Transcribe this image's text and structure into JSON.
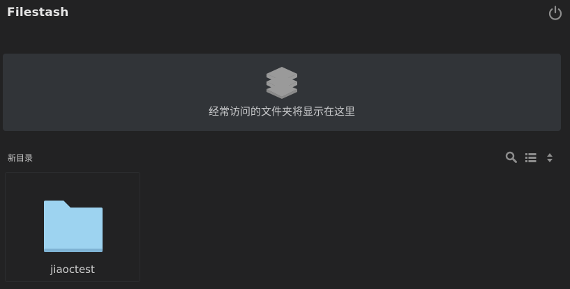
{
  "header": {
    "app_title": "Filestash",
    "power_icon": "power-icon"
  },
  "frequent": {
    "icon": "layers-icon",
    "message": "经常访问的文件夹将显示在这里"
  },
  "section": {
    "title": "新目录",
    "tools": [
      "search-icon",
      "list-view-icon",
      "sort-icon"
    ]
  },
  "files": [
    {
      "name": "jiaoctest",
      "type": "folder",
      "icon": "folder-icon"
    }
  ],
  "colors": {
    "background": "#222223",
    "panel": "#313438",
    "folder": "#9dd3f0",
    "folder_dark": "#7fb3d4",
    "icon_gray": "#8e8e8e"
  }
}
